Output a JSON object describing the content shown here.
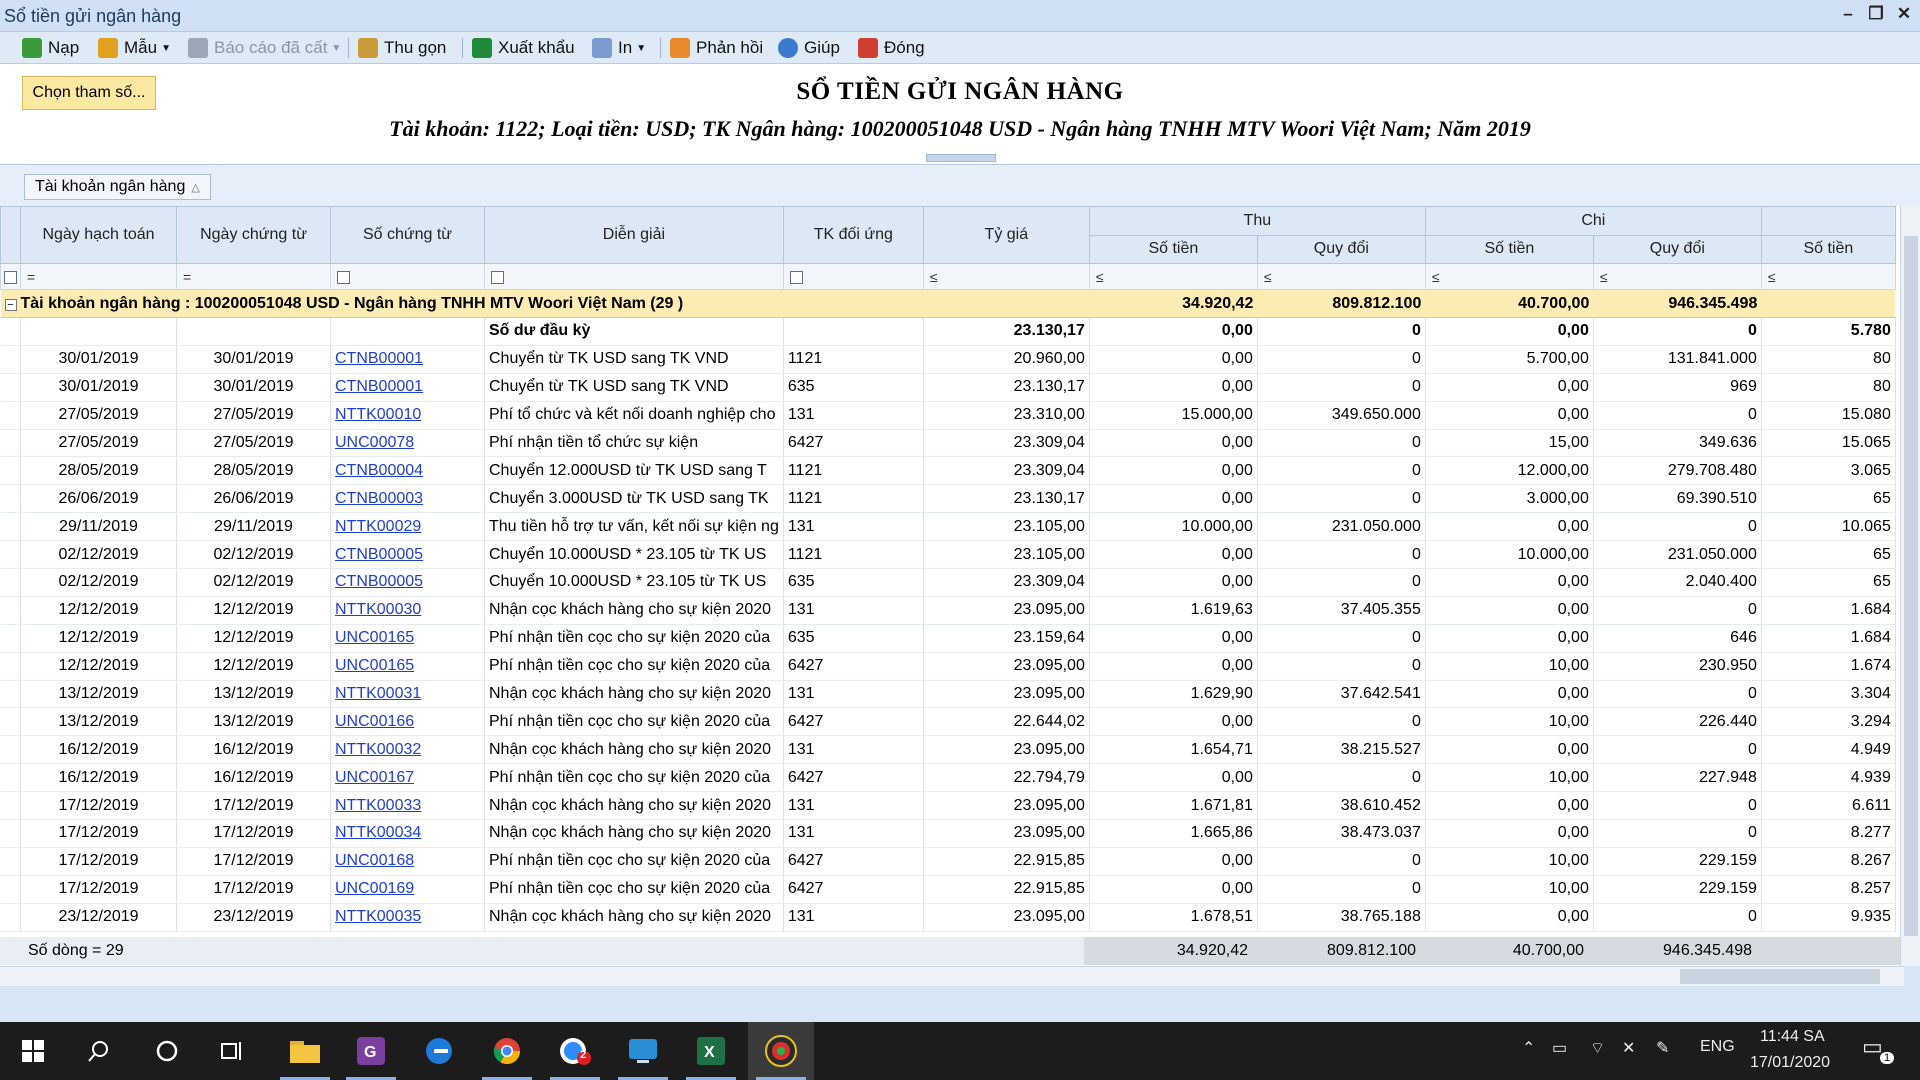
{
  "window": {
    "title": "Sổ tiền gửi ngân hàng"
  },
  "toolbar": {
    "nap": "Nạp",
    "mau": "Mẫu",
    "bao_cao": "Báo cáo đã cất",
    "thu_gon": "Thu gọn",
    "xuat_khau": "Xuất khẩu",
    "in": "In",
    "phan_hoi": "Phản hồi",
    "giup": "Giúp",
    "dong": "Đóng"
  },
  "params_button": "Chọn tham số...",
  "report": {
    "title": "SỔ TIỀN GỬI NGÂN HÀNG",
    "subtitle": "Tài khoản: 1122; Loại tiền: USD; TK Ngân hàng: 100200051048 USD - Ngân hàng TNHH MTV Woori Việt Nam; Năm 2019"
  },
  "group_chip": "Tài khoản ngân hàng",
  "columns": {
    "ngay_hach_toan": "Ngày hạch toán",
    "ngay_chung_tu": "Ngày chứng từ",
    "so_chung_tu": "Số chứng từ",
    "dien_giai": "Diễn giải",
    "tk_doi_ung": "TK đối ứng",
    "ty_gia": "Tỷ giá",
    "thu": "Thu",
    "chi": "Chi",
    "so_tien": "Số tiền",
    "quy_doi": "Quy đổi"
  },
  "filter_ops": {
    "eq": "=",
    "le": "≤"
  },
  "group_row": {
    "label": "Tài khoản ngân hàng : 100200051048 USD - Ngân hàng TNHH MTV Woori Việt Nam (29 )",
    "thu_so_tien": "34.920,42",
    "thu_quy_doi": "809.812.100",
    "chi_so_tien": "40.700,00",
    "chi_quy_doi": "946.345.498"
  },
  "opening_row": {
    "label": "Số dư đầu kỳ",
    "ty_gia": "23.130,17",
    "thu_so_tien": "0,00",
    "thu_quy_doi": "0",
    "chi_so_tien": "0,00",
    "chi_quy_doi": "0",
    "ton": "5.780"
  },
  "rows": [
    [
      "30/01/2019",
      "30/01/2019",
      "CTNB00001",
      "Chuyển từ TK USD sang TK VND",
      "1121",
      "20.960,00",
      "0,00",
      "0",
      "5.700,00",
      "131.841.000",
      "80"
    ],
    [
      "30/01/2019",
      "30/01/2019",
      "CTNB00001",
      "Chuyển từ TK USD sang TK VND",
      "635",
      "23.130,17",
      "0,00",
      "0",
      "0,00",
      "969",
      "80"
    ],
    [
      "27/05/2019",
      "27/05/2019",
      "NTTK00010",
      "Phí tổ chức và kết nối doanh nghiệp cho",
      "131",
      "23.310,00",
      "15.000,00",
      "349.650.000",
      "0,00",
      "0",
      "15.080"
    ],
    [
      "27/05/2019",
      "27/05/2019",
      "UNC00078",
      "Phí nhận tiền tổ chức sự kiện",
      "6427",
      "23.309,04",
      "0,00",
      "0",
      "15,00",
      "349.636",
      "15.065"
    ],
    [
      "28/05/2019",
      "28/05/2019",
      "CTNB00004",
      "Chuyển 12.000USD từ TK USD sang T",
      "1121",
      "23.309,04",
      "0,00",
      "0",
      "12.000,00",
      "279.708.480",
      "3.065"
    ],
    [
      "26/06/2019",
      "26/06/2019",
      "CTNB00003",
      "Chuyển 3.000USD từ TK USD sang TK",
      "1121",
      "23.130,17",
      "0,00",
      "0",
      "3.000,00",
      "69.390.510",
      "65"
    ],
    [
      "29/11/2019",
      "29/11/2019",
      "NTTK00029",
      "Thu tiền hỗ trợ tư vấn, kết nối sự kiện ng",
      "131",
      "23.105,00",
      "10.000,00",
      "231.050.000",
      "0,00",
      "0",
      "10.065"
    ],
    [
      "02/12/2019",
      "02/12/2019",
      "CTNB00005",
      "Chuyển 10.000USD * 23.105 từ TK US",
      "1121",
      "23.105,00",
      "0,00",
      "0",
      "10.000,00",
      "231.050.000",
      "65"
    ],
    [
      "02/12/2019",
      "02/12/2019",
      "CTNB00005",
      "Chuyển 10.000USD * 23.105 từ TK US",
      "635",
      "23.309,04",
      "0,00",
      "0",
      "0,00",
      "2.040.400",
      "65"
    ],
    [
      "12/12/2019",
      "12/12/2019",
      "NTTK00030",
      "Nhận cọc khách hàng cho sự kiện 2020",
      "131",
      "23.095,00",
      "1.619,63",
      "37.405.355",
      "0,00",
      "0",
      "1.684"
    ],
    [
      "12/12/2019",
      "12/12/2019",
      "UNC00165",
      "Phí nhận tiền cọc cho sự kiện 2020 của",
      "635",
      "23.159,64",
      "0,00",
      "0",
      "0,00",
      "646",
      "1.684"
    ],
    [
      "12/12/2019",
      "12/12/2019",
      "UNC00165",
      "Phí nhận tiền cọc cho sự kiện 2020 của",
      "6427",
      "23.095,00",
      "0,00",
      "0",
      "10,00",
      "230.950",
      "1.674"
    ],
    [
      "13/12/2019",
      "13/12/2019",
      "NTTK00031",
      "Nhận cọc khách hàng cho sự kiện 2020",
      "131",
      "23.095,00",
      "1.629,90",
      "37.642.541",
      "0,00",
      "0",
      "3.304"
    ],
    [
      "13/12/2019",
      "13/12/2019",
      "UNC00166",
      "Phí nhận tiền cọc cho sự kiện 2020 của",
      "6427",
      "22.644,02",
      "0,00",
      "0",
      "10,00",
      "226.440",
      "3.294"
    ],
    [
      "16/12/2019",
      "16/12/2019",
      "NTTK00032",
      "Nhận cọc khách hàng cho sự kiện 2020",
      "131",
      "23.095,00",
      "1.654,71",
      "38.215.527",
      "0,00",
      "0",
      "4.949"
    ],
    [
      "16/12/2019",
      "16/12/2019",
      "UNC00167",
      "Phí nhận tiền cọc cho sự kiện 2020 của",
      "6427",
      "22.794,79",
      "0,00",
      "0",
      "10,00",
      "227.948",
      "4.939"
    ],
    [
      "17/12/2019",
      "17/12/2019",
      "NTTK00033",
      "Nhận cọc khách hàng cho sự kiện 2020",
      "131",
      "23.095,00",
      "1.671,81",
      "38.610.452",
      "0,00",
      "0",
      "6.611"
    ],
    [
      "17/12/2019",
      "17/12/2019",
      "NTTK00034",
      "Nhận cọc khách hàng cho sự kiện 2020",
      "131",
      "23.095,00",
      "1.665,86",
      "38.473.037",
      "0,00",
      "0",
      "8.277"
    ],
    [
      "17/12/2019",
      "17/12/2019",
      "UNC00168",
      "Phí nhận tiền cọc cho sự kiện 2020 của",
      "6427",
      "22.915,85",
      "0,00",
      "0",
      "10,00",
      "229.159",
      "8.267"
    ],
    [
      "17/12/2019",
      "17/12/2019",
      "UNC00169",
      "Phí nhận tiền cọc cho sự kiện 2020 của",
      "6427",
      "22.915,85",
      "0,00",
      "0",
      "10,00",
      "229.159",
      "8.257"
    ],
    [
      "23/12/2019",
      "23/12/2019",
      "NTTK00035",
      "Nhận cọc khách hàng cho sự kiện 2020",
      "131",
      "23.095,00",
      "1.678,51",
      "38.765.188",
      "0,00",
      "0",
      "9.935"
    ]
  ],
  "footer": {
    "row_count": "Số dòng = 29",
    "thu_so_tien": "34.920,42",
    "thu_quy_doi": "809.812.100",
    "chi_so_tien": "40.700,00",
    "chi_quy_doi": "946.345.498"
  },
  "taskbar": {
    "lang": "ENG",
    "time": "11:44 SA",
    "date": "17/01/2020",
    "zoom_badge": "2",
    "notif_badge": "1"
  },
  "colors": {
    "group_row": "#fbecb3",
    "header": "#dce8f5",
    "link": "#1f3fcf",
    "params_button": "#fbe9a2"
  }
}
